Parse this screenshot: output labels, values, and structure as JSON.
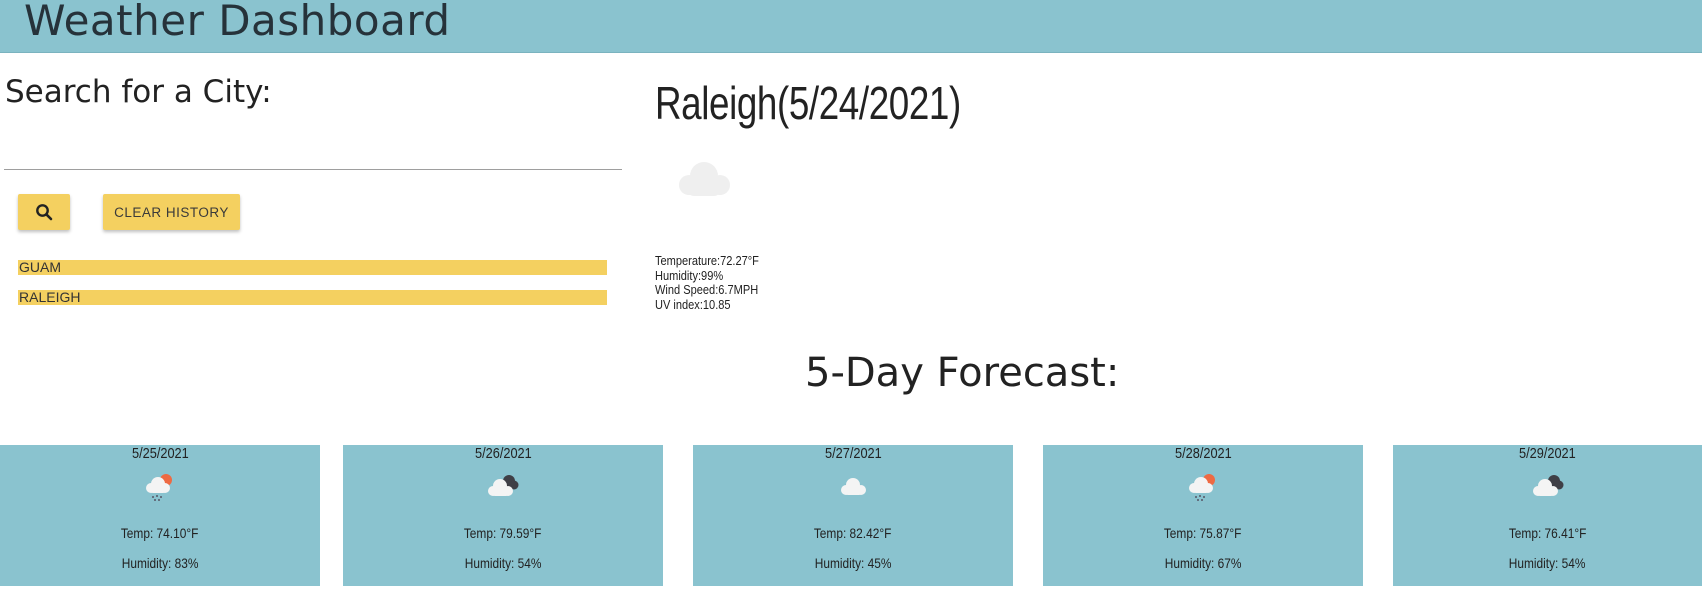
{
  "header": {
    "title": "Weather Dashboard"
  },
  "search": {
    "title": "Search for a City:",
    "input_value": "",
    "search_icon": "search-icon",
    "clear_label": "CLEAR HISTORY"
  },
  "history": [
    {
      "label": "GUAM"
    },
    {
      "label": "RALEIGH"
    }
  ],
  "current": {
    "title": "Raleigh(5/24/2021)",
    "icon": "cloud-icon",
    "temperature": "Temperature:72.27°F",
    "humidity": "Humidity:99%",
    "wind": "Wind Speed:6.7MPH",
    "uv": "UV index:10.85"
  },
  "forecast": {
    "title": "5-Day Forecast:",
    "days": [
      {
        "date": "5/25/2021",
        "icon": "sun-rain-cloud-icon",
        "temp": "Temp: 74.10°F",
        "humidity": "Humidity: 83%"
      },
      {
        "date": "5/26/2021",
        "icon": "broken-clouds-icon",
        "temp": "Temp: 79.59°F",
        "humidity": "Humidity: 54%"
      },
      {
        "date": "5/27/2021",
        "icon": "cloud-icon",
        "temp": "Temp: 82.42°F",
        "humidity": "Humidity: 45%"
      },
      {
        "date": "5/28/2021",
        "icon": "sun-rain-cloud-icon",
        "temp": "Temp: 75.87°F",
        "humidity": "Humidity: 67%"
      },
      {
        "date": "5/29/2021",
        "icon": "broken-clouds-icon",
        "temp": "Temp: 76.41°F",
        "humidity": "Humidity: 54%"
      }
    ]
  },
  "colors": {
    "header_bg": "#8ac3cf",
    "button_bg": "#f4d060",
    "card_bg": "#8ac3cf"
  }
}
